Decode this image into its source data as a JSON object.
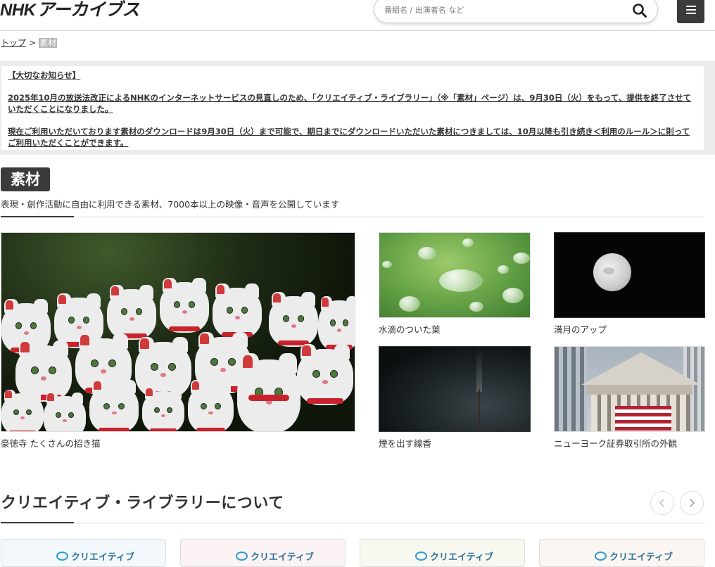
{
  "header": {
    "logo_nhk": "NHK",
    "logo_archives": "アーカイブス",
    "search_placeholder": "番組名 / 出演者名 など",
    "search_icon": "search-icon",
    "menu_icon": "hamburger-menu-icon"
  },
  "breadcrumb": {
    "top": "トップ",
    "separator": ">",
    "current": "素材"
  },
  "notice": {
    "heading": "【大切なお知らせ】",
    "paragraph1": "2025年10月の放送法改正によるNHKのインターネットサービスの見直しのため、「クリエイティブ・ライブラリー」（※「素材」ページ）は、9月30日（火）をもって、提供を終了させていただくことになりました。",
    "paragraph2": "現在ご利用いただいております素材のダウンロードは9月30日（火）まで可能で、期日までにダウンロードいただいた素材につきましては、10月以降も引き続き＜利用のルール＞に則ってご利用いただくことができます。"
  },
  "section": {
    "title": "素材",
    "description": "表現・創作活動に自由に利用できる素材、7000本以上の映像・音声を公開しています"
  },
  "cards": [
    {
      "caption": "豪徳寺 たくさんの招き猫"
    },
    {
      "caption": "水滴のついた葉"
    },
    {
      "caption": "満月のアップ"
    },
    {
      "caption": "煙を出す線香"
    },
    {
      "caption": "ニューヨーク証券取引所の外観"
    }
  ],
  "about": {
    "title": "クリエイティブ・ライブラリーについて",
    "prev_icon": "chevron-left-icon",
    "next_icon": "chevron-right-icon",
    "card_label": "クリエイティブ",
    "card_colors": [
      "#f2f8fb",
      "#fbf3f3",
      "#f8f8f1",
      "#fbf6f1"
    ]
  }
}
